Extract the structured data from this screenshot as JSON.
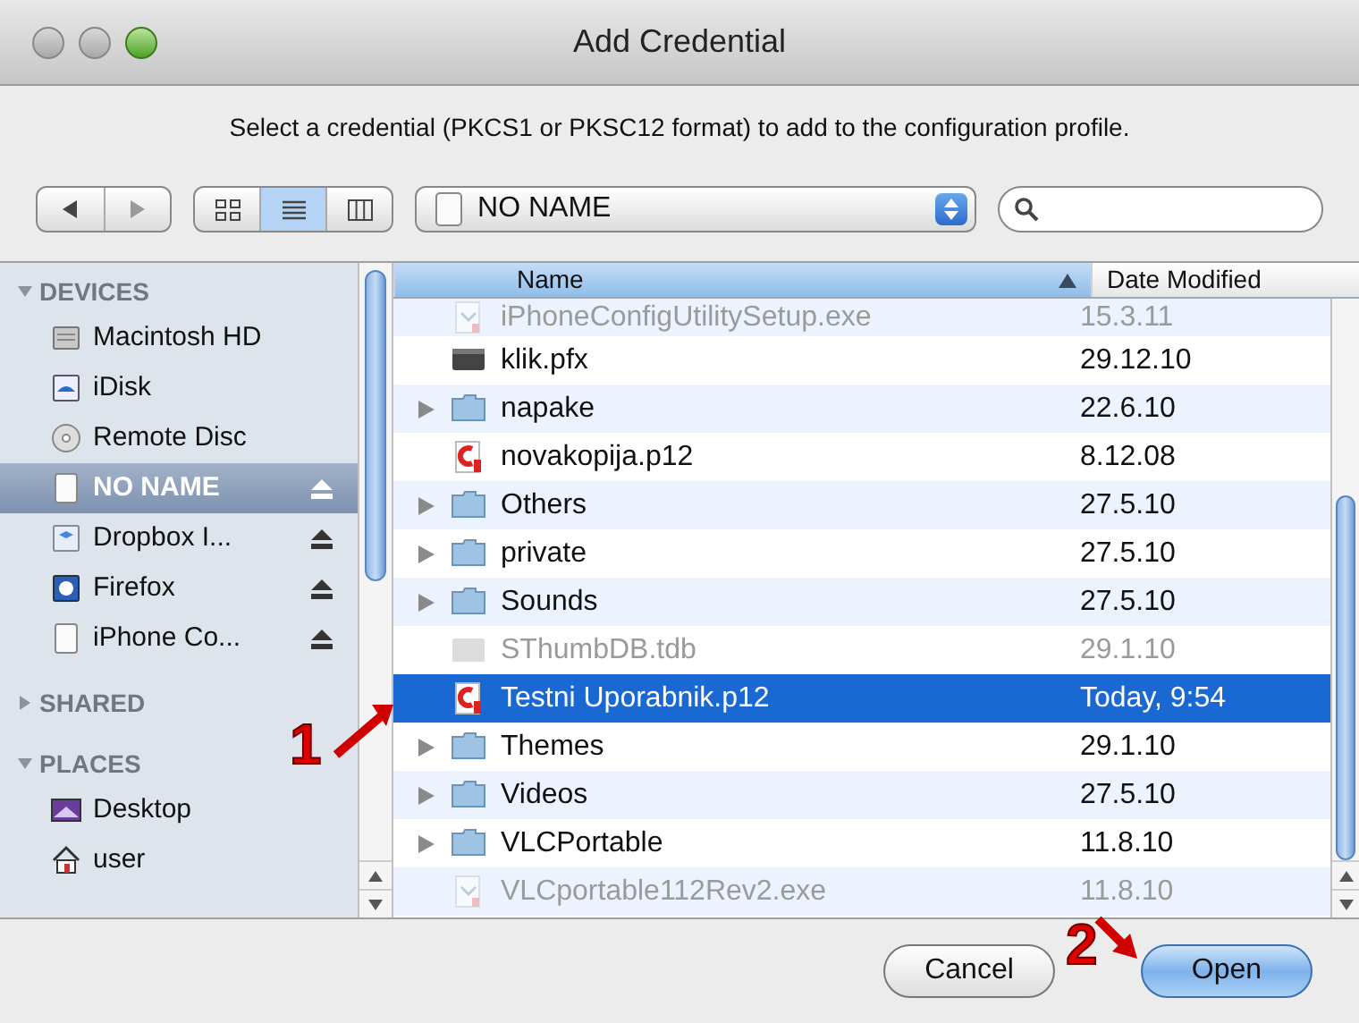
{
  "window": {
    "title": "Add Credential"
  },
  "instruction": "Select a credential (PKCS1 or PKSC12 format) to add to the configuration profile.",
  "location": {
    "value": "NO NAME"
  },
  "view_modes": [
    {
      "kind": "icons",
      "selected": false
    },
    {
      "kind": "list",
      "selected": true
    },
    {
      "kind": "columns",
      "selected": false
    }
  ],
  "sidebar": {
    "sections": [
      {
        "title": "DEVICES",
        "expanded": true,
        "items": [
          {
            "label": "Macintosh HD",
            "kind": "disk",
            "selected": false,
            "eject": false
          },
          {
            "label": "iDisk",
            "kind": "idisk",
            "selected": false,
            "eject": false
          },
          {
            "label": "Remote Disc",
            "kind": "disc",
            "selected": false,
            "eject": false
          },
          {
            "label": "NO NAME",
            "kind": "volume",
            "selected": true,
            "eject": true
          },
          {
            "label": "Dropbox I...",
            "kind": "dropbox",
            "selected": false,
            "eject": true
          },
          {
            "label": "Firefox",
            "kind": "firefox",
            "selected": false,
            "eject": true
          },
          {
            "label": "iPhone Co...",
            "kind": "volume",
            "selected": false,
            "eject": true
          }
        ]
      },
      {
        "title": "SHARED",
        "expanded": false
      },
      {
        "title": "PLACES",
        "expanded": true,
        "items": [
          {
            "label": "Desktop",
            "kind": "desktop",
            "selected": false,
            "eject": false
          },
          {
            "label": "user",
            "kind": "home",
            "selected": false,
            "eject": false
          }
        ]
      }
    ]
  },
  "table": {
    "columns": [
      {
        "label": "Name",
        "sorted": true
      },
      {
        "label": "Date Modified",
        "sorted": false
      }
    ],
    "rows": [
      {
        "name": "iPhoneConfigUtilitySetup.exe",
        "date": "15.3.11",
        "kind": "installer",
        "disabled": true,
        "selected": false
      },
      {
        "name": "klik.pfx",
        "date": "29.12.10",
        "kind": "document",
        "disabled": false,
        "selected": false
      },
      {
        "name": "napake",
        "date": "22.6.10",
        "kind": "folder",
        "disabled": false,
        "selected": false
      },
      {
        "name": "novakopija.p12",
        "date": "8.12.08",
        "kind": "certificate",
        "disabled": false,
        "selected": false
      },
      {
        "name": "Others",
        "date": "27.5.10",
        "kind": "folder",
        "disabled": false,
        "selected": false
      },
      {
        "name": "private",
        "date": "27.5.10",
        "kind": "folder",
        "disabled": false,
        "selected": false
      },
      {
        "name": "Sounds",
        "date": "27.5.10",
        "kind": "folder",
        "disabled": false,
        "selected": false
      },
      {
        "name": "SThumbDB.tdb",
        "date": "29.1.10",
        "kind": "generic",
        "disabled": true,
        "selected": false
      },
      {
        "name": "Testni Uporabnik.p12",
        "date": "Today, 9:54",
        "kind": "certificate",
        "disabled": false,
        "selected": true
      },
      {
        "name": "Themes",
        "date": "29.1.10",
        "kind": "folder",
        "disabled": false,
        "selected": false
      },
      {
        "name": "Videos",
        "date": "27.5.10",
        "kind": "folder",
        "disabled": false,
        "selected": false
      },
      {
        "name": "VLCPortable",
        "date": "11.8.10",
        "kind": "folder",
        "disabled": false,
        "selected": false
      },
      {
        "name": "VLCportable112Rev2.exe",
        "date": "11.8.10",
        "kind": "installer",
        "disabled": true,
        "selected": false
      }
    ]
  },
  "buttons": [
    {
      "label": "Cancel",
      "default": false
    },
    {
      "label": "Open",
      "default": true
    }
  ],
  "annotations": [
    {
      "label": "1"
    },
    {
      "label": "2"
    }
  ]
}
